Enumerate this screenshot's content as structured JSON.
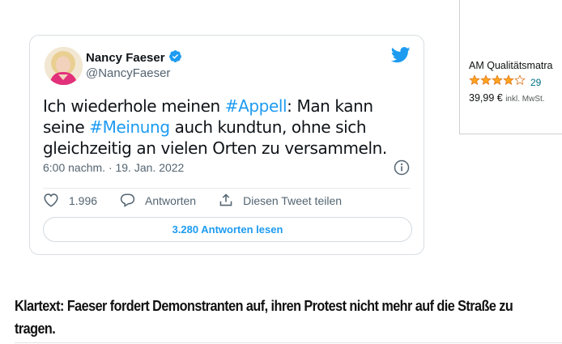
{
  "tweet": {
    "author_name": "Nancy Faeser",
    "author_handle": "@NancyFaeser",
    "text_parts": {
      "p1": "Ich wiederhole meinen ",
      "h1": "#Appell",
      "p2": ": Man kann seine ",
      "h2": "#Meinung",
      "p3": " auch kundtun, ohne sich gleichzeitig an vielen Orten zu versammeln."
    },
    "timestamp": "6:00 nachm. · 19. Jan. 2022",
    "likes": "1.996",
    "reply_label": "Antworten",
    "share_label": "Diesen Tweet teilen",
    "read_replies_label": "3.280 Antworten lesen",
    "icons": [
      "verified-badge-icon",
      "twitter-bird-icon",
      "info-icon",
      "heart-icon",
      "reply-bubble-icon",
      "share-icon"
    ],
    "colors": {
      "accent": "#1d9bf0",
      "text": "#0f1419",
      "muted": "#536471"
    }
  },
  "ad": {
    "title": "AM Qualitätsmatra",
    "rating": 4,
    "rating_max": 5,
    "rating_count": "29",
    "price": "39,99 €",
    "price_note": "inkl. MwSt.",
    "colors": {
      "star": "#ffa41c"
    }
  },
  "caption": {
    "text": "Klartext: Faeser fordert Demonstranten auf, ihren Protest nicht mehr auf die Straße zu tragen."
  }
}
